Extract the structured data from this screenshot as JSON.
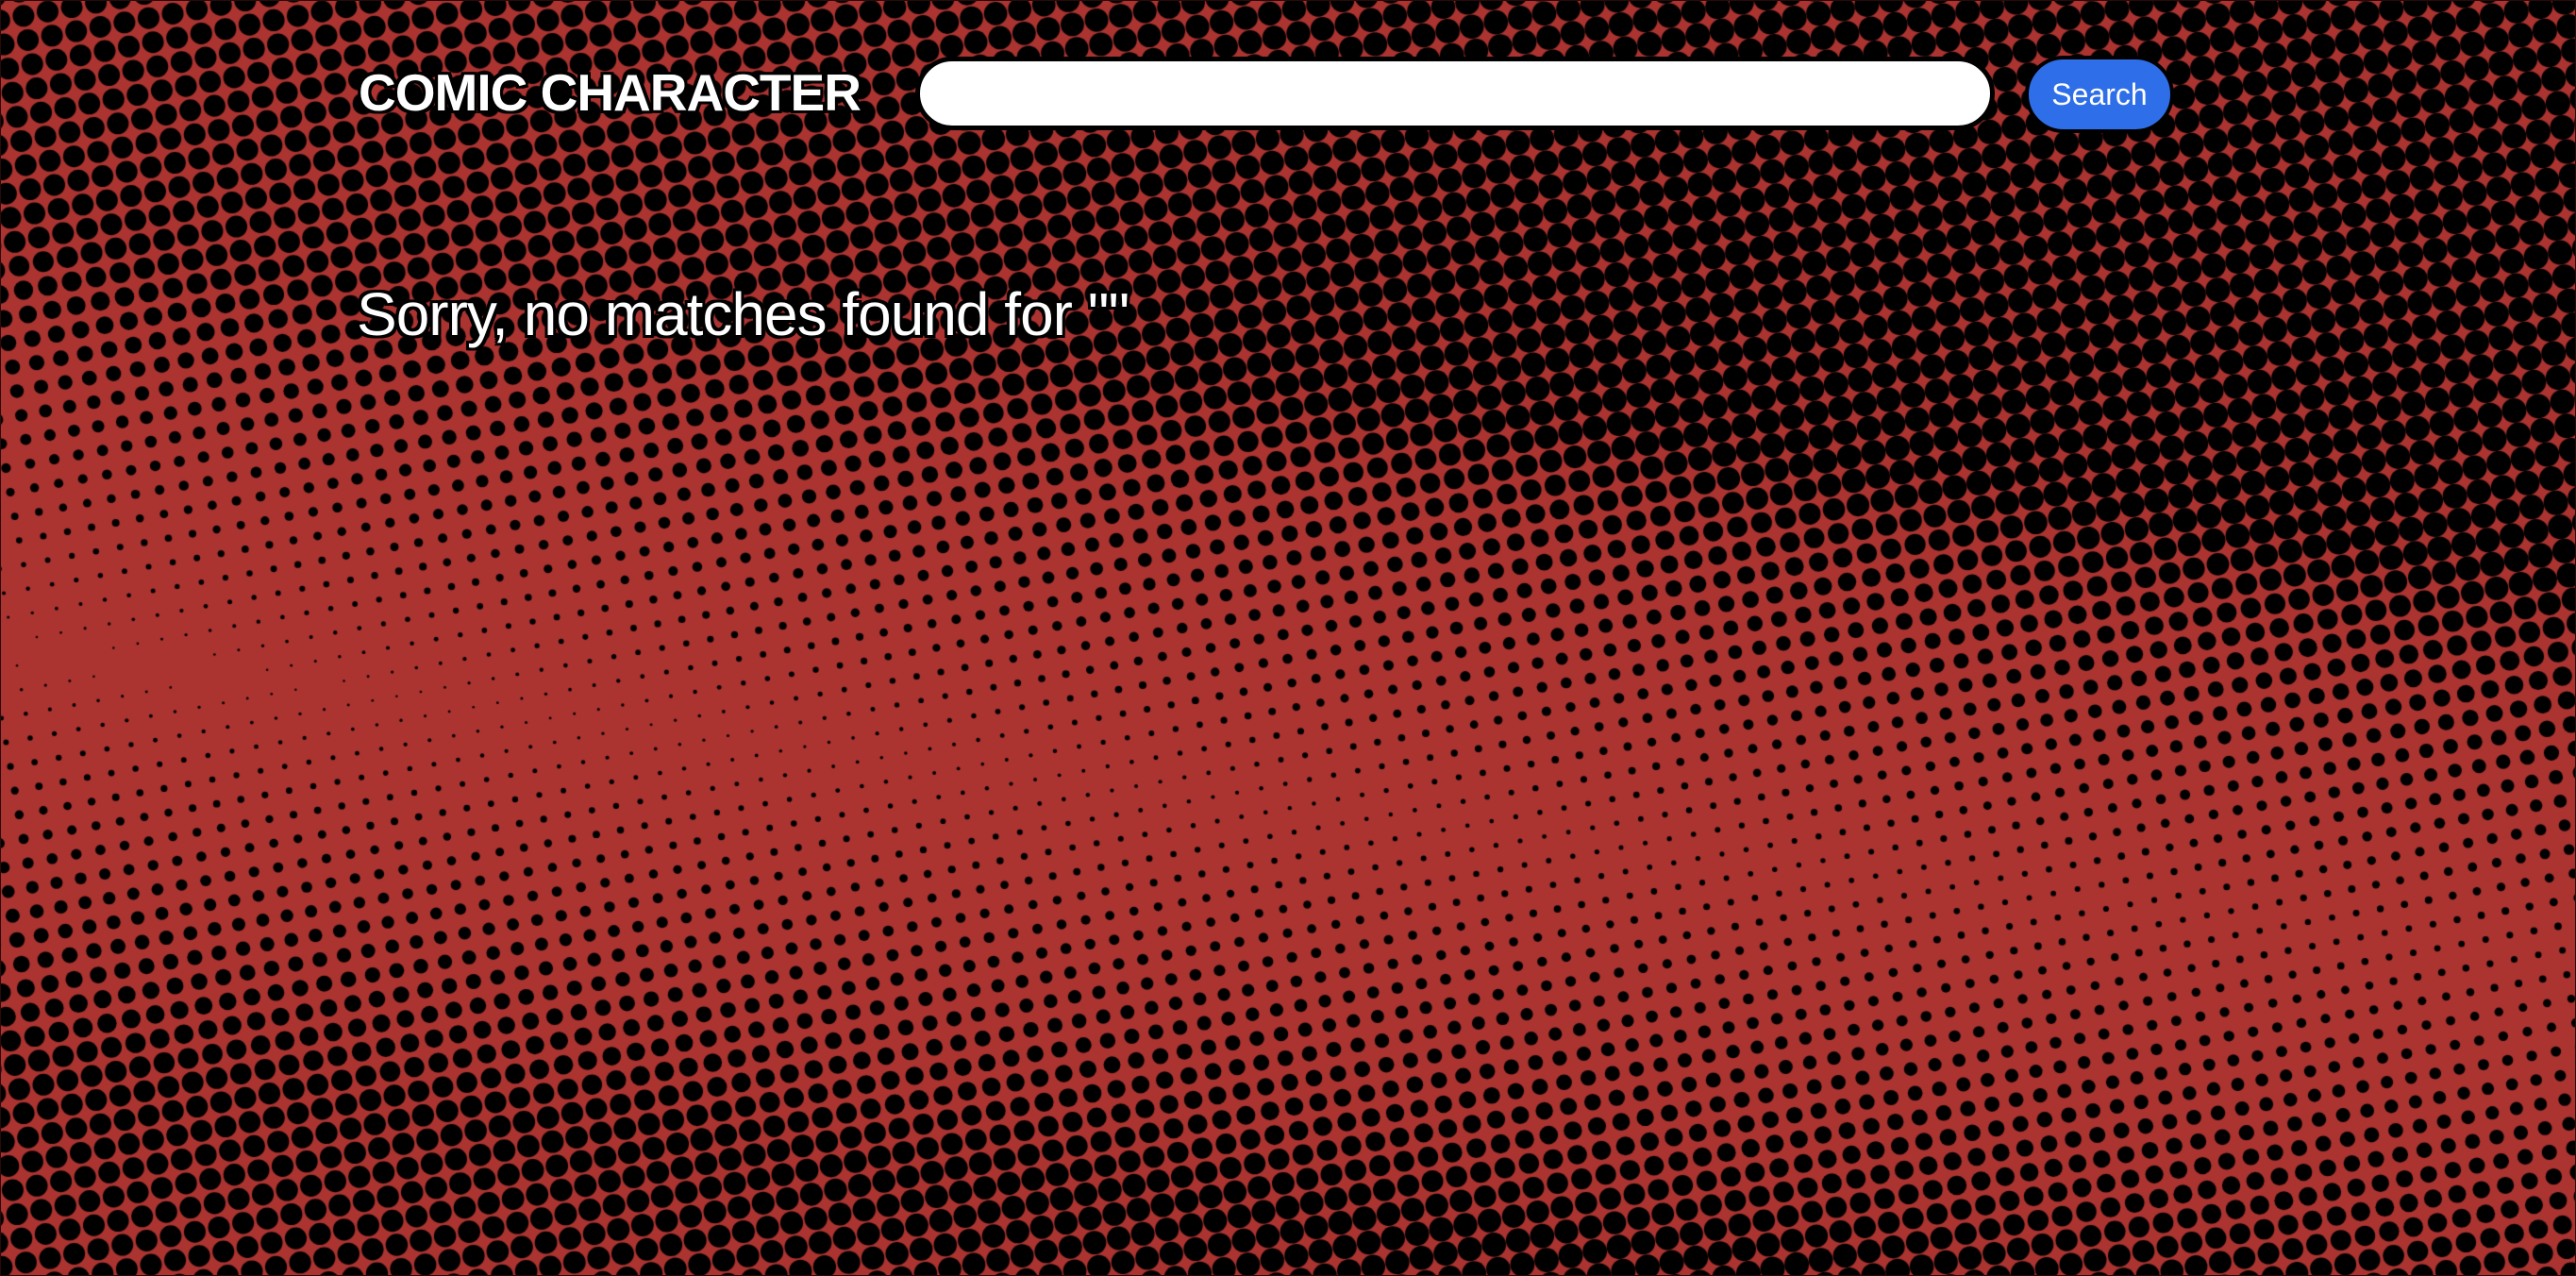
{
  "app": {
    "logo_text": "COMIC CHARACTER"
  },
  "search": {
    "value": "",
    "placeholder": "",
    "button_label": "Search"
  },
  "results": {
    "message": "Sorry, no matches found for \"\""
  },
  "colors": {
    "background": "#ab3431",
    "dots": "#000000",
    "button": "#2e6ee8",
    "text": "#ffffff"
  }
}
